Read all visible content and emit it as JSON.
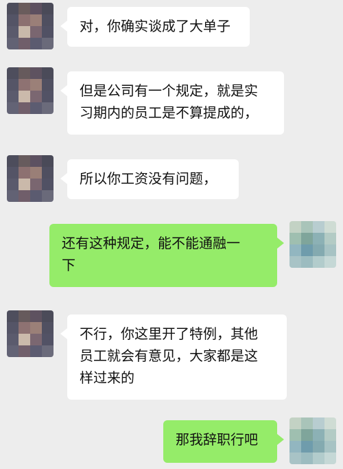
{
  "conversation": {
    "messages": [
      {
        "side": "left",
        "text": "对，你确实谈成了大单子"
      },
      {
        "side": "left",
        "text": "但是公司有一个规定，就是实\n习期内的员工是不算提成的，"
      },
      {
        "side": "left",
        "text": "所以你工资没有问题，"
      },
      {
        "side": "right",
        "text": "还有这种规定，能不能通融一\n下"
      },
      {
        "side": "left",
        "text": "不行，你这里开了特例，其他\n员工就会有意见，大家都是这\n样过来的"
      },
      {
        "side": "right",
        "text": "那我辞职行吧"
      }
    ]
  },
  "colors": {
    "background": "#ededed",
    "incoming_bubble": "#ffffff",
    "outgoing_bubble": "#95ec69"
  },
  "avatars": {
    "contact": "blurred-avatar",
    "self": "blurred-avatar"
  }
}
